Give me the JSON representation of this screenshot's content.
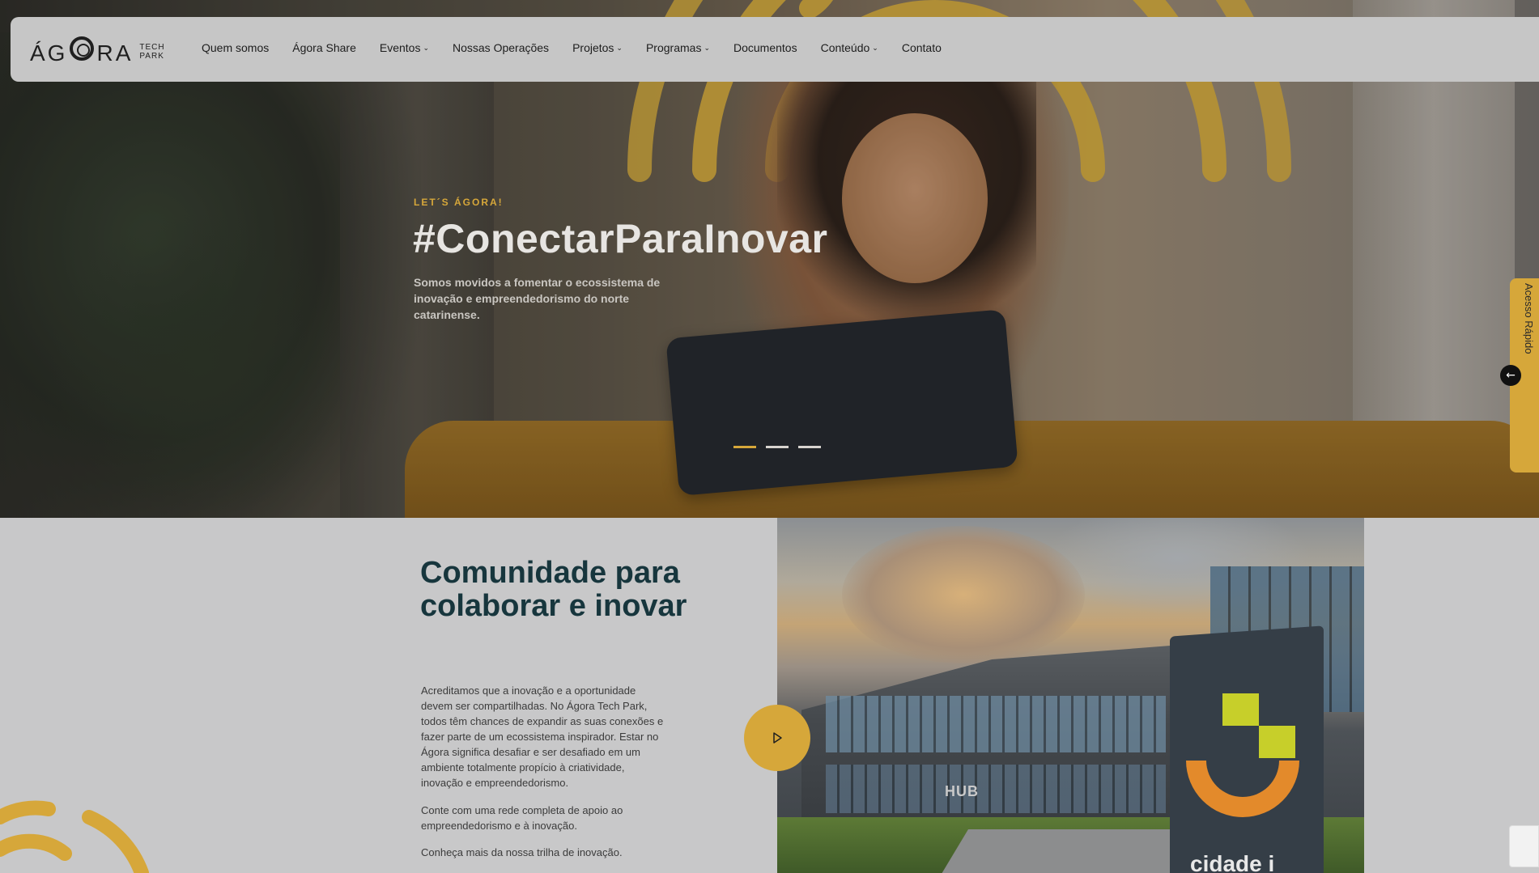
{
  "header": {
    "logo": {
      "word": "ÁGORA",
      "tag_line1": "TECH",
      "tag_line2": "PARK"
    },
    "nav": [
      {
        "label": "Quem somos",
        "dropdown": false
      },
      {
        "label": "Ágora Share",
        "dropdown": false
      },
      {
        "label": "Eventos",
        "dropdown": true
      },
      {
        "label": "Nossas Operações",
        "dropdown": false
      },
      {
        "label": "Projetos",
        "dropdown": true
      },
      {
        "label": "Programas",
        "dropdown": true
      },
      {
        "label": "Documentos",
        "dropdown": false
      },
      {
        "label": "Conteúdo",
        "dropdown": true
      },
      {
        "label": "Contato",
        "dropdown": false
      }
    ]
  },
  "hero": {
    "eyebrow": "LET´S ÁGORA!",
    "title": "#ConectarParaInovar",
    "subtitle": "Somos movidos a fomentar o ecossistema de inovação e empreendedorismo do norte catarinense.",
    "slides": 3,
    "active_slide": 1,
    "quick_access_label": "Acesso Rápido"
  },
  "section": {
    "title": "Comunidade para colaborar e inovar",
    "p1": "Acreditamos que a inovação e a oportunidade devem ser compartilhadas. No Ágora Tech Park, todos têm chances de expandir as suas conexões e fazer parte de um ecossistema inspirador. Estar no Ágora significa desafiar e ser desafiado em um ambiente totalmente propício à criatividade, inovação e empreendedorismo.",
    "p2": "Conte com uma rede completa de apoio ao empreendedorismo e à inovação.",
    "p3": "Conheça mais da nossa trilha de inovação.",
    "photo_sign": "HUB",
    "photo_totem_text": "cidade i"
  },
  "colors": {
    "accent": "#d6a73a",
    "dark_teal": "#17363d",
    "header_bg": "#c6c6c6"
  },
  "icons": {
    "play": "play-icon",
    "arrow_left": "arrow-left-icon",
    "chevron": "chevron-down-icon"
  }
}
